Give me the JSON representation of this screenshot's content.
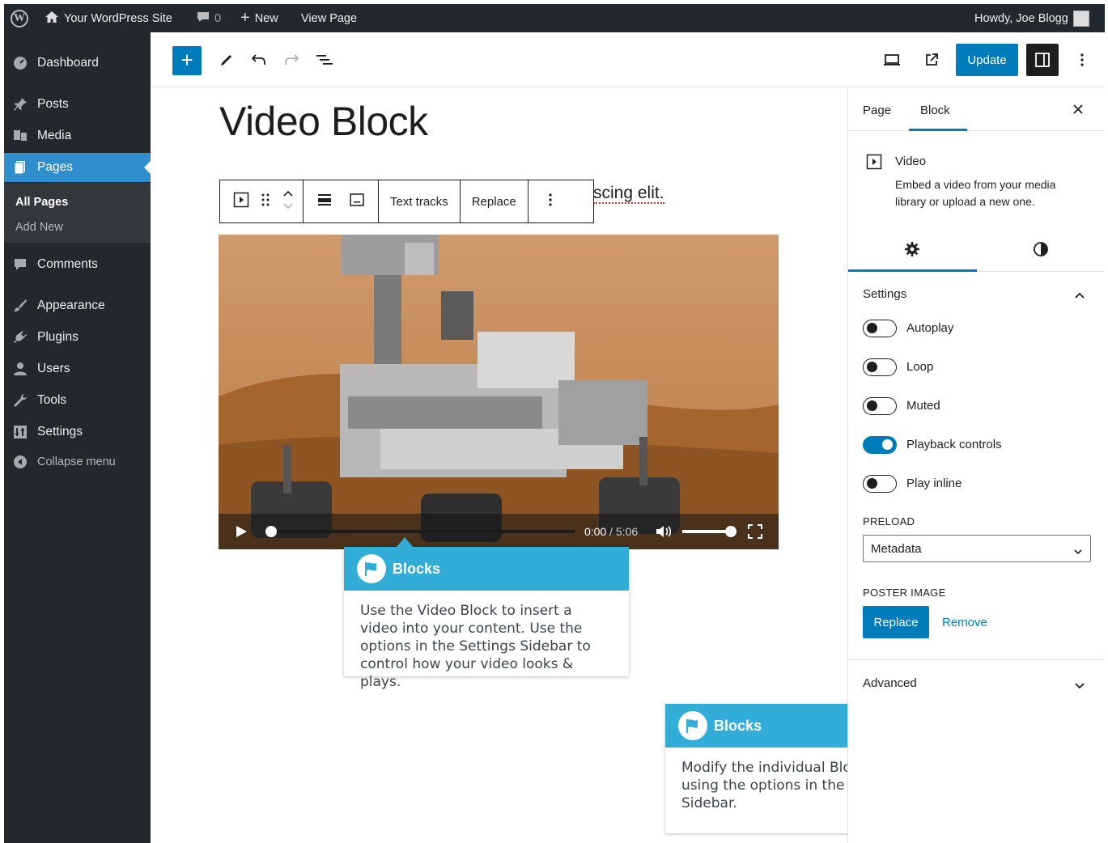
{
  "admin_bar": {
    "site_name": "Your WordPress Site",
    "comments_count": "0",
    "new_label": "New",
    "view_page": "View Page",
    "howdy": "Howdy, Joe Blogg"
  },
  "sidebar": {
    "dashboard": "Dashboard",
    "posts": "Posts",
    "media": "Media",
    "pages": "Pages",
    "all_pages": "All Pages",
    "add_new": "Add New",
    "comments": "Comments",
    "appearance": "Appearance",
    "plugins": "Plugins",
    "users": "Users",
    "tools": "Tools",
    "settings": "Settings",
    "collapse": "Collapse menu"
  },
  "toolbar": {
    "update_label": "Update"
  },
  "editor": {
    "title": "Video Block",
    "paragraph_fragment": "scing elit.",
    "block_toolbar": {
      "text_tracks": "Text tracks",
      "replace": "Replace"
    },
    "video": {
      "time_current": "0:00",
      "time_total": "/ 5:06",
      "progress": 0.0,
      "volume": 1.0
    }
  },
  "tooltips": [
    {
      "title": "Blocks",
      "body": "Use the Video Block to insert a video into your content. Use the options in the Settings Sidebar to control how your video looks & plays."
    },
    {
      "title": "Blocks",
      "body": "Modify the individual Block Settings using the options in the Settings Sidebar."
    }
  ],
  "panel": {
    "tab_page": "Page",
    "tab_block": "Block",
    "block_name": "Video",
    "block_desc": "Embed a video from your media library or upload a new one.",
    "settings_heading": "Settings",
    "toggles": [
      {
        "label": "Autoplay",
        "on": false
      },
      {
        "label": "Loop",
        "on": false
      },
      {
        "label": "Muted",
        "on": false
      },
      {
        "label": "Playback controls",
        "on": true
      },
      {
        "label": "Play inline",
        "on": false
      }
    ],
    "preload_label": "PRELOAD",
    "preload_value": "Metadata",
    "poster_label": "POSTER IMAGE",
    "poster_replace": "Replace",
    "poster_remove": "Remove",
    "advanced": "Advanced"
  },
  "colors": {
    "admin_dark": "#23282d",
    "accent": "#007cba",
    "active_menu": "#2e8ece",
    "tooltip": "#31add8"
  }
}
